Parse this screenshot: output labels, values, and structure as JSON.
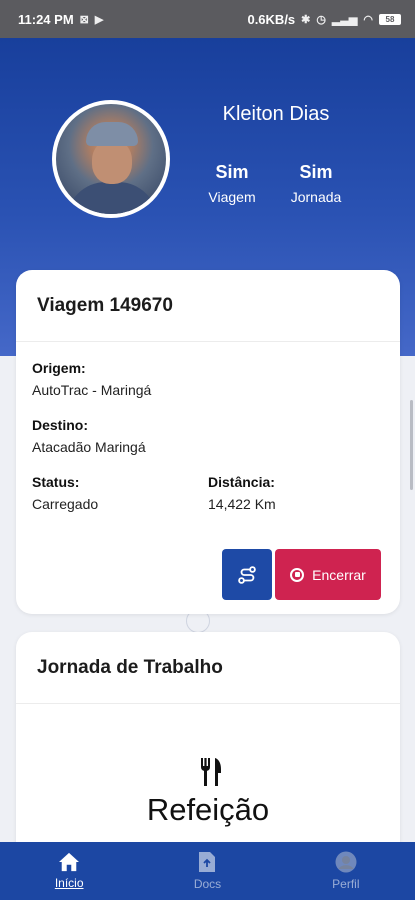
{
  "status_bar": {
    "time": "11:24 PM",
    "speed": "0.6KB/s",
    "battery": "58"
  },
  "profile": {
    "name": "Kleiton Dias",
    "stats": [
      {
        "value": "Sim",
        "label": "Viagem"
      },
      {
        "value": "Sim",
        "label": "Jornada"
      }
    ]
  },
  "trip": {
    "title": "Viagem 149670",
    "origin_label": "Origem:",
    "origin_value": "AutoTrac - Maringá",
    "destination_label": "Destino:",
    "destination_value": "Atacadão Maringá",
    "status_label": "Status:",
    "status_value": "Carregado",
    "distance_label": "Distância:",
    "distance_value": "14,422 Km",
    "end_button": "Encerrar"
  },
  "journey": {
    "title": "Jornada de Trabalho",
    "meal_label": "Refeição"
  },
  "nav": [
    {
      "label": "Início",
      "icon": "home-icon"
    },
    {
      "label": "Docs",
      "icon": "document-icon"
    },
    {
      "label": "Perfil",
      "icon": "profile-avatar-icon"
    }
  ],
  "colors": {
    "primary": "#1c47a3",
    "danger": "#cf2350"
  }
}
